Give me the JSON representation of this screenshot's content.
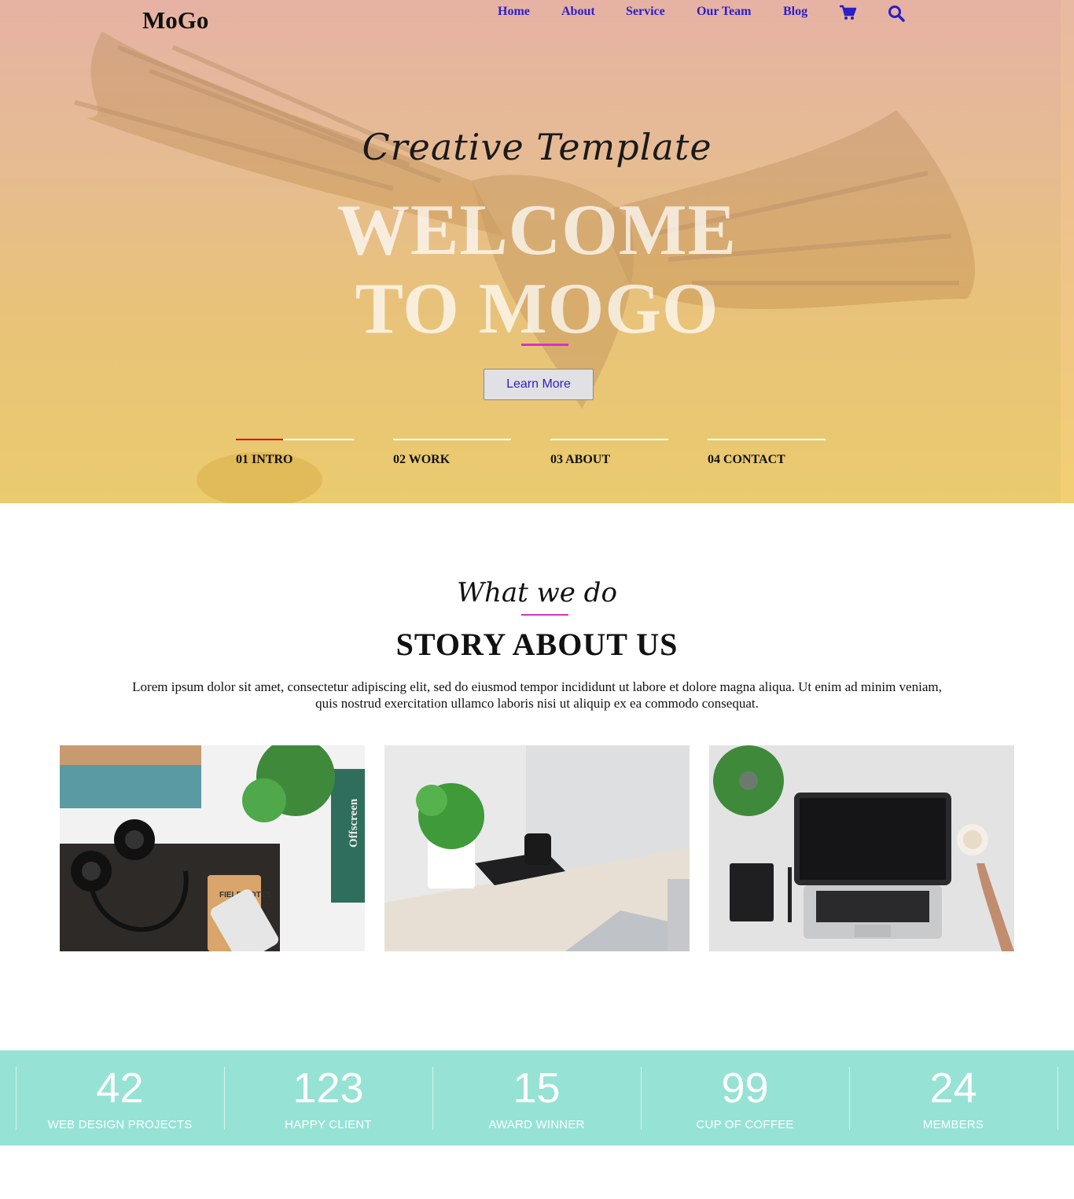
{
  "header": {
    "logo": "MoGo",
    "nav": [
      {
        "label": "Home"
      },
      {
        "label": "About"
      },
      {
        "label": "Service"
      },
      {
        "label": "Our Team"
      },
      {
        "label": "Blog"
      }
    ],
    "icons": [
      "cart-icon",
      "search-icon"
    ]
  },
  "hero": {
    "tagline": "Creative Template",
    "headline_line1": "WELCOME",
    "headline_line2": "TO MOGO",
    "cta_label": "Learn More",
    "steps": [
      {
        "label": "01 INTRO",
        "progress": 0.4
      },
      {
        "label": "02 WORK",
        "progress": 0
      },
      {
        "label": "03 ABOUT",
        "progress": 0
      },
      {
        "label": "04 CONTACT",
        "progress": 0
      }
    ]
  },
  "story": {
    "subtitle": "What we do",
    "title": "STORY ABOUT US",
    "text": "Lorem ipsum dolor sit amet, consectetur adipiscing elit, sed do eiusmod tempor incididunt ut labore et dolore magna aliqua. Ut enim ad minim veniam, quis nostrud exercitation ullamco laboris nisi ut aliquip ex ea commodo consequat.",
    "photos": [
      "workspace-headphones-photo",
      "desk-plant-camera-photo",
      "laptop-coffee-photo"
    ],
    "photo_texts": {
      "field_notes": "FIELD NOTES",
      "offscreen": "Offscreen"
    }
  },
  "stats": [
    {
      "value": "42",
      "label": "WEB DESIGN PROJECTS"
    },
    {
      "value": "123",
      "label": "HAPPY CLIENT"
    },
    {
      "value": "15",
      "label": "AWARD WINNER"
    },
    {
      "value": "99",
      "label": "CUP OF COFFEE"
    },
    {
      "value": "24",
      "label": "MEMBERS"
    }
  ],
  "colors": {
    "nav_link": "#2b1fc6",
    "accent_line": "#d633c6",
    "step_active": "#e60000",
    "stats_bg": "#96e3d5"
  }
}
